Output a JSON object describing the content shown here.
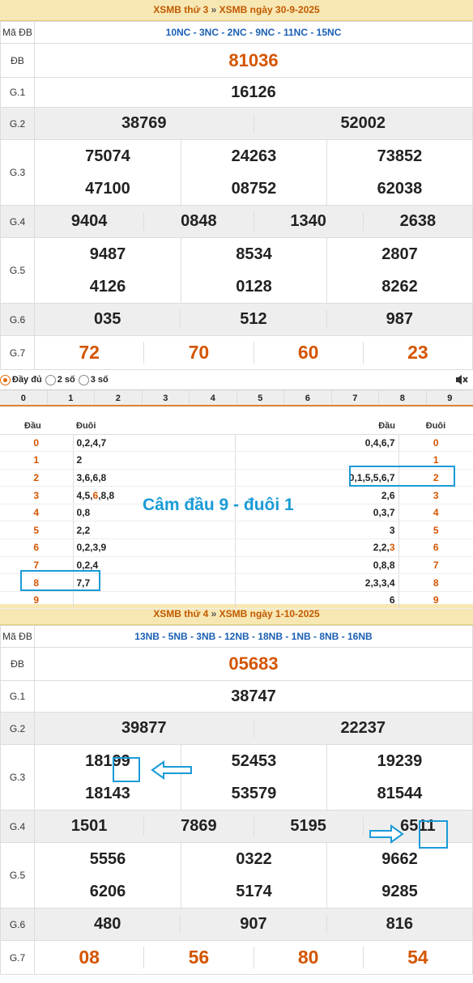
{
  "day1": {
    "header": {
      "part1": "XSMB thứ 3",
      "sep": "»",
      "part2": "XSMB ngày 30-9-2025"
    },
    "ma_db_label": "Mã ĐB",
    "ma_db": "10NC - 3NC - 2NC - 9NC - 11NC - 15NC",
    "labels": {
      "db": "ĐB",
      "g1": "G.1",
      "g2": "G.2",
      "g3": "G.3",
      "g4": "G.4",
      "g5": "G.5",
      "g6": "G.6",
      "g7": "G.7"
    },
    "db": "81036",
    "g1": "16126",
    "g2": [
      "38769",
      "52002"
    ],
    "g3": [
      "75074",
      "24263",
      "73852",
      "47100",
      "08752",
      "62038"
    ],
    "g4": [
      "9404",
      "0848",
      "1340",
      "2638"
    ],
    "g5": [
      "9487",
      "8534",
      "2807",
      "4126",
      "0128",
      "8262"
    ],
    "g6": [
      "035",
      "512",
      "987"
    ],
    "g7": [
      "72",
      "70",
      "60",
      "23"
    ]
  },
  "options": {
    "full": "Đầy đủ",
    "two": "2 số",
    "three": "3 số",
    "mute_icon": "speaker-mute-icon"
  },
  "digits": [
    "0",
    "1",
    "2",
    "3",
    "4",
    "5",
    "6",
    "7",
    "8",
    "9"
  ],
  "loto": {
    "head_dau": "Đầu",
    "head_duoi": "Đuôi",
    "rows": [
      {
        "dau": "0",
        "duoi": "0,2,4,7",
        "duoi_rev": "0,4,6,7",
        "dau_rev": "0"
      },
      {
        "dau": "1",
        "duoi": "2",
        "duoi_rev": "",
        "dau_rev": "1"
      },
      {
        "dau": "2",
        "duoi": "3,6,6,8",
        "duoi_rev": "0,1,5,5,6,7",
        "dau_rev": "2"
      },
      {
        "dau": "3",
        "duoi_a": "4,5,",
        "duoi_b": "6",
        "duoi_c": ",8,8",
        "duoi_rev_a": "2,6",
        "duoi_rev_b": "",
        "dau_rev": "3"
      },
      {
        "dau": "4",
        "duoi": "0,8",
        "duoi_rev": "0,3,7",
        "dau_rev": "4"
      },
      {
        "dau": "5",
        "duoi": "2,2",
        "duoi_rev": "3",
        "dau_rev": "5"
      },
      {
        "dau": "6",
        "duoi": "0,2,3,9",
        "duoi_rev_a": "2,2,",
        "duoi_rev_b": "3",
        "dau_rev": "6"
      },
      {
        "dau": "7",
        "duoi": "0,2,4",
        "duoi_rev": "0,8,8",
        "dau_rev": "7"
      },
      {
        "dau": "8",
        "duoi": "7,7",
        "duoi_rev": "2,3,3,4",
        "dau_rev": "8"
      },
      {
        "dau": "9",
        "duoi": "",
        "duoi_rev": "6",
        "dau_rev": "9"
      }
    ],
    "note": "Câm đầu 9 - đuôi 1"
  },
  "day2": {
    "header": {
      "part1": "XSMB thứ 4",
      "sep": "»",
      "part2": "XSMB ngày 1-10-2025"
    },
    "ma_db_label": "Mã ĐB",
    "ma_db": "13NB - 5NB - 3NB - 12NB - 18NB - 1NB - 8NB - 16NB",
    "labels": {
      "db": "ĐB",
      "g1": "G.1",
      "g2": "G.2",
      "g3": "G.3",
      "g4": "G.4",
      "g5": "G.5",
      "g6": "G.6",
      "g7": "G.7"
    },
    "db": "05683",
    "g1": "38747",
    "g2": [
      "39877",
      "22237"
    ],
    "g3": [
      "18199",
      "52453",
      "19239",
      "18143",
      "53579",
      "81544"
    ],
    "g4": [
      "1501",
      "7869",
      "5195",
      "6511"
    ],
    "g5": [
      "5556",
      "0322",
      "9662",
      "6206",
      "5174",
      "9285"
    ],
    "g6": [
      "480",
      "907",
      "816"
    ],
    "g7": [
      "08",
      "56",
      "80",
      "54"
    ]
  },
  "colors": {
    "accent": "#d45500",
    "blue": "#1a9bd7",
    "header_bg": "#f7e7b3"
  }
}
